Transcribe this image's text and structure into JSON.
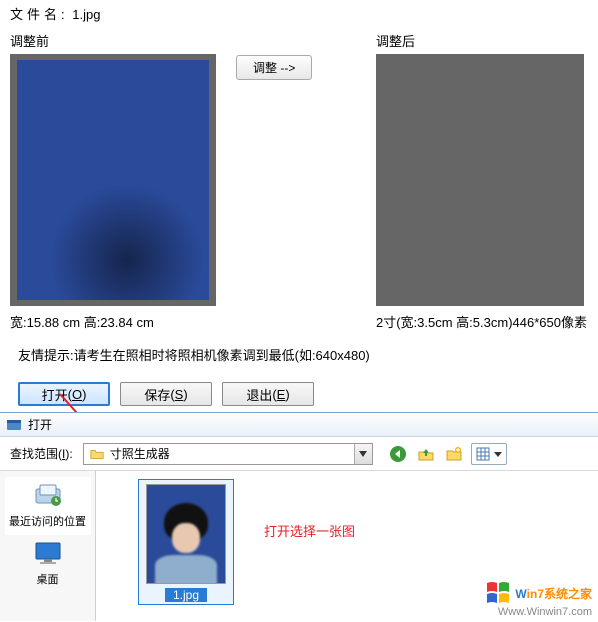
{
  "filename_label": "文件名:",
  "filename_value": "1.jpg",
  "before_title": "调整前",
  "after_title": "调整后",
  "adjust_button": "调整 -->",
  "before_caption": "宽:15.88 cm 高:23.84 cm",
  "after_caption": "2寸(宽:3.5cm 高:5.3cm)446*650像素",
  "hint": "友情提示:请考生在照相时将照相机像素调到最低(如:640x480)",
  "actions": {
    "open": {
      "text": "打开",
      "key": "O"
    },
    "save": {
      "text": "保存",
      "key": "S"
    },
    "exit": {
      "text": "退出",
      "key": "E"
    }
  },
  "dialog": {
    "title": "打开",
    "lookin_label": "查找范围",
    "lookin_key": "I",
    "lookin_value": "寸照生成器",
    "places": {
      "recent": "最近访问的位置",
      "desktop": "桌面"
    },
    "selected_file": "1.jpg",
    "annotation": "打开选择一张图"
  },
  "watermark": {
    "brand_prefix": "W",
    "brand_in": "in",
    "brand_suffix": "7系统之家",
    "url": "Www.Winwin7.com"
  }
}
